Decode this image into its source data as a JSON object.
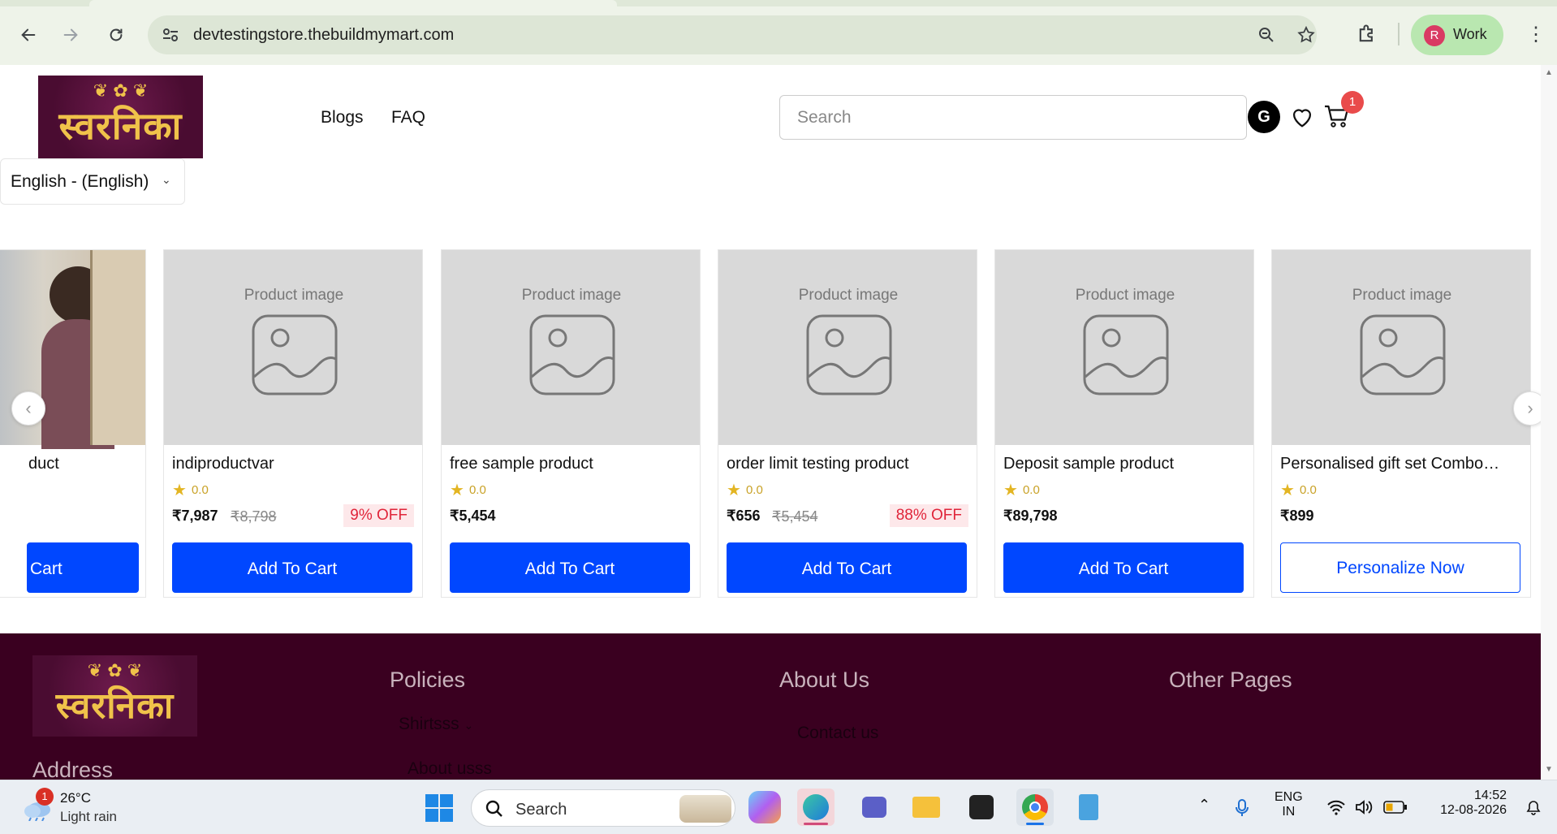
{
  "browser": {
    "url": "devtestingstore.thebuildmymart.com",
    "profile_initial": "R",
    "profile_label": "Work"
  },
  "header": {
    "logo_text": "स्वरनिका",
    "menu": [
      "Blogs",
      "FAQ"
    ],
    "search_placeholder": "Search",
    "user_initial": "G",
    "cart_count": "1",
    "language": "English - (English)"
  },
  "products": [
    {
      "title": "duct",
      "button": "Cart",
      "partial": true
    },
    {
      "title": "indiproductvar",
      "rating": "0.0",
      "price": "₹7,987",
      "original_price": "₹8,798",
      "discount": "9% OFF",
      "button": "Add To Cart",
      "image_label": "Product image"
    },
    {
      "title": "free sample product",
      "rating": "0.0",
      "price": "₹5,454",
      "button": "Add To Cart",
      "image_label": "Product image"
    },
    {
      "title": "order limit testing product",
      "rating": "0.0",
      "price": "₹656",
      "original_price": "₹5,454",
      "discount": "88% OFF",
      "button": "Add To Cart",
      "image_label": "Product image"
    },
    {
      "title": "Deposit sample product",
      "rating": "0.0",
      "price": "₹89,798",
      "button": "Add To Cart",
      "image_label": "Product image"
    },
    {
      "title": "Personalised gift set Combo…",
      "rating": "0.0",
      "price": "₹899",
      "button": "Personalize Now",
      "image_label": "Product image"
    }
  ],
  "footer": {
    "logo_text": "स्वरनिका",
    "policies_heading": "Policies",
    "about_heading": "About Us",
    "other_heading": "Other Pages",
    "address_heading": "Address",
    "policies_link": "Shirtsss",
    "policies_link2": "About usss",
    "about_link": "Contact us"
  },
  "taskbar": {
    "temperature": "26°C",
    "weather": "Light rain",
    "weather_badge": "1",
    "search_label": "Search",
    "lang_top": "ENG",
    "lang_bottom": "IN",
    "time": "14:52",
    "date": "12-08-2026"
  },
  "colors": {
    "accent": "#0047ff",
    "footer_bg": "#3a0020",
    "discount": "#e0253a",
    "badge": "#e94b4b"
  }
}
